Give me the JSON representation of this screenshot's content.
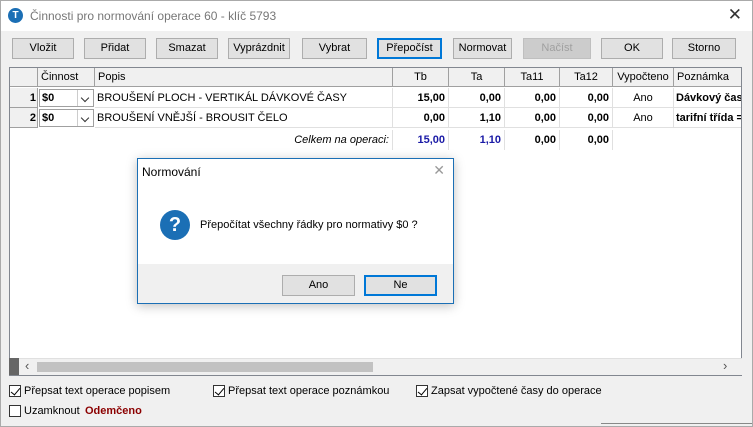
{
  "window": {
    "title": "Činnosti pro normování operace 60 - klíč 5793",
    "close_glyph": "✕"
  },
  "toolbar": {
    "vlozit": "Vložit",
    "pridat": "Přidat",
    "smazat": "Smazat",
    "vyprazdnit": "Vyprázdnit",
    "vybrat": "Vybrat",
    "prepocist": "Přepočíst",
    "normovat": "Normovat",
    "nacist": "Načíst",
    "ok": "OK",
    "storno": "Storno"
  },
  "grid": {
    "columns": [
      "Činnost",
      "Popis",
      "Tb",
      "Ta",
      "Ta11",
      "Ta12",
      "Vypočteno",
      "Poznámka"
    ],
    "rows": [
      {
        "num": "1",
        "cinnost": "$0",
        "popis": "BROUŠENÍ PLOCH - VERTIKÁL  DÁVKOVÉ ČASY",
        "tb": "15,00",
        "ta": "0,00",
        "ta11": "0,00",
        "ta12": "0,00",
        "vypocteno": "Ano",
        "poznamka": "Dávkový čas"
      },
      {
        "num": "2",
        "cinnost": "$0",
        "popis": "BROUŠENÍ VNĚJŠÍ  -  BROUSIT ČELO",
        "tb": "0,00",
        "ta": "1,10",
        "ta11": "0,00",
        "ta12": "0,00",
        "vypocteno": "Ano",
        "poznamka": "tarifní třída ="
      }
    ],
    "total": {
      "label": "Celkem na operaci:",
      "tb": "15,00",
      "ta": "1,10",
      "ta11": "0,00",
      "ta12": "0,00"
    }
  },
  "options": {
    "prepsat_popisem": "Přepsat text operace popisem",
    "prepsat_poznamkou": "Přepsat text operace poznámkou",
    "zapsat_casy": "Zapsat vypočtené časy do operace",
    "uzamknout": "Uzamknout",
    "lock_status": "Odemčeno"
  },
  "checks": {
    "prepsat_popisem": true,
    "prepsat_poznamkou": true,
    "zapsat_casy": true,
    "uzamknout": false
  },
  "dialog": {
    "title": "Normování",
    "close_glyph": "✕",
    "icon_glyph": "?",
    "message": "Přepočítat všechny řádky pro normativy $0 ?",
    "yes": "Ano",
    "no": "Ne"
  },
  "scroll": {
    "left_arrow": "‹",
    "right_arrow": "›"
  },
  "colors": {
    "accent": "#0078d7",
    "icon_blue": "#1b6fb5",
    "total_blue": "#1a1aa6",
    "lock_red": "#8b0000"
  },
  "icons": {
    "app": "app-logo-icon",
    "dialog": "question-icon"
  }
}
